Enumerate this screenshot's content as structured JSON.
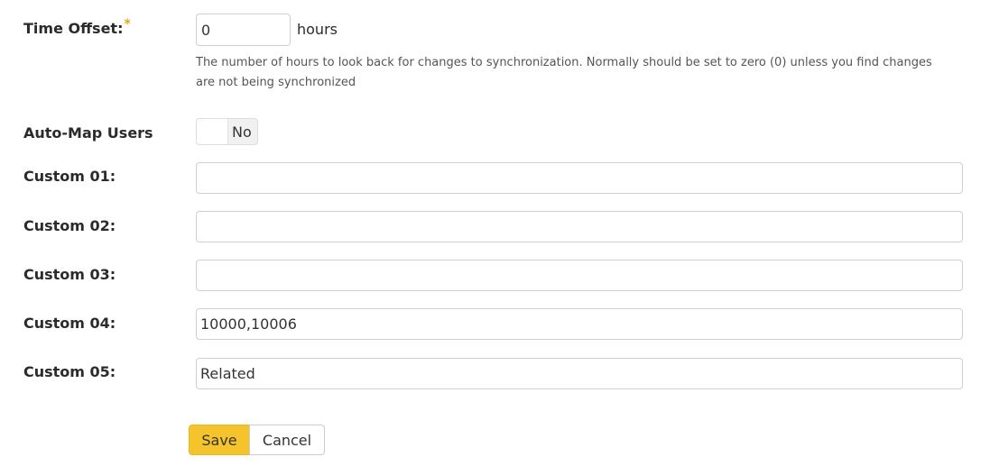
{
  "time_offset": {
    "label": "Time Offset:",
    "required_mark": "*",
    "value": "0",
    "unit": "hours",
    "help_text": "The number of hours to look back for changes to synchronization. Normally should be set to zero (0) unless you find changes are not being synchronized"
  },
  "auto_map_users": {
    "label": "Auto-Map Users",
    "state_text": "No",
    "enabled": false
  },
  "custom_fields": [
    {
      "label": "Custom 01:",
      "value": ""
    },
    {
      "label": "Custom 02:",
      "value": ""
    },
    {
      "label": "Custom 03:",
      "value": ""
    },
    {
      "label": "Custom 04:",
      "value": "10000,10006"
    },
    {
      "label": "Custom 05:",
      "value": "Related"
    }
  ],
  "actions": {
    "save_label": "Save",
    "cancel_label": "Cancel"
  },
  "colors": {
    "required_star": "#f0a30a",
    "save_button": "#f5c42c",
    "input_border": "#cfcfcf"
  }
}
